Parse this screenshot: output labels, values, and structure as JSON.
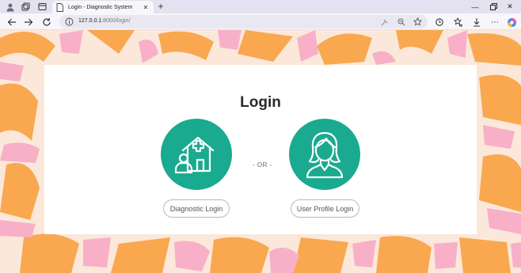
{
  "browser": {
    "tab_title": "Login - Diagnostic System",
    "url_host": "127.0.0.1",
    "url_rest": ":8000/login/"
  },
  "page": {
    "heading": "Login",
    "separator": "- OR -",
    "options": [
      {
        "label": "Diagnostic Login",
        "icon": "clinic-building-icon"
      },
      {
        "label": "User Profile Login",
        "icon": "woman-user-icon"
      }
    ]
  },
  "colors": {
    "accent": "#1aaa8f",
    "orange": "#f9a850",
    "pink": "#f8b0c8",
    "cream": "#fbe8da"
  }
}
